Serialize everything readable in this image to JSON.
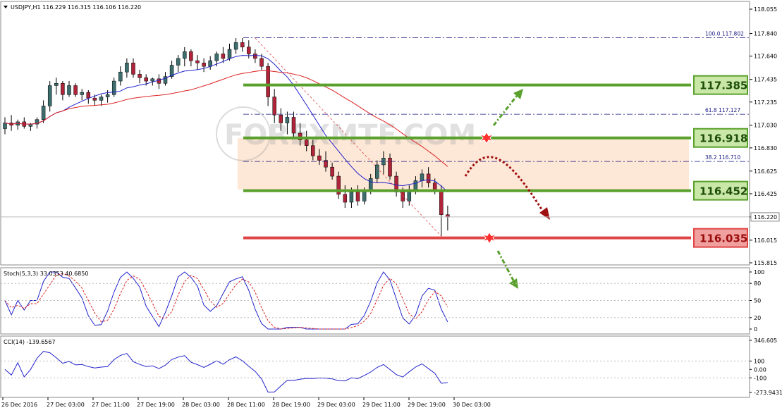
{
  "header": {
    "symbol_info": "USDJPY,H1  116.229 116.315 116.106 116.220",
    "stoch_info": "Stoch(5,3,3) 33.0353 40.6850",
    "cci_info": "CCI(14) -139.6567"
  },
  "watermark": "FOREXMTF.COM",
  "price_axis": {
    "ticks": [
      "118.055",
      "117.840",
      "117.640",
      "117.435",
      "117.235",
      "117.030",
      "116.830",
      "116.625",
      "116.425",
      "116.220",
      "116.015",
      "115.815"
    ],
    "current": "116.220"
  },
  "stoch_axis": {
    "ticks": [
      "100",
      "80",
      "50",
      "20",
      "0"
    ]
  },
  "cci_axis": {
    "ticks": [
      "346.605",
      "100",
      "0.00",
      "-100",
      "-273.9431"
    ]
  },
  "time_axis": {
    "ticks": [
      "26 Dec 2016",
      "27 Dec 03:00",
      "27 Dec 11:00",
      "27 Dec 19:00",
      "28 Dec 03:00",
      "28 Dec 11:00",
      "28 Dec 19:00",
      "29 Dec 03:00",
      "29 Dec 11:00",
      "29 Dec 19:00",
      "30 Dec 03:00"
    ]
  },
  "fib_levels": [
    {
      "label": "100.0  117.802",
      "price": 117.802
    },
    {
      "label": "61.8  117.127",
      "price": 117.127
    },
    {
      "label": "38.2  116.710",
      "price": 116.71
    }
  ],
  "levels": [
    {
      "label": "117.385",
      "price": 117.385,
      "color": "#5aa02c",
      "kind": "resistance"
    },
    {
      "label": "116.918",
      "price": 116.918,
      "color": "#5aa02c",
      "kind": "resistance"
    },
    {
      "label": "116.452",
      "price": 116.452,
      "color": "#5aa02c",
      "kind": "support"
    },
    {
      "label": "116.035",
      "price": 116.035,
      "color": "#e04545",
      "kind": "support"
    }
  ],
  "colors": {
    "bull": "#3d6e6e",
    "bear": "#b0243a",
    "ma_fast": "#2222cc",
    "ma_slow": "#dd2222",
    "green": "#5aa02c",
    "red": "#e04545",
    "zone": "#fde3cf"
  },
  "chart_data": {
    "type": "candlestick",
    "symbol": "USDJPY",
    "timeframe": "H1",
    "ohlc": [
      [
        117.0,
        117.1,
        116.95,
        117.05
      ],
      [
        117.05,
        117.12,
        116.98,
        117.03
      ],
      [
        117.03,
        117.08,
        116.99,
        117.06
      ],
      [
        117.06,
        117.1,
        117.0,
        117.02
      ],
      [
        117.02,
        117.05,
        116.98,
        117.04
      ],
      [
        117.04,
        117.1,
        117.0,
        117.08
      ],
      [
        117.08,
        117.25,
        117.05,
        117.2
      ],
      [
        117.2,
        117.42,
        117.15,
        117.38
      ],
      [
        117.38,
        117.45,
        117.3,
        117.4
      ],
      [
        117.4,
        117.42,
        117.25,
        117.3
      ],
      [
        117.3,
        117.42,
        117.28,
        117.38
      ],
      [
        117.38,
        117.4,
        117.28,
        117.3
      ],
      [
        117.3,
        117.35,
        117.25,
        117.32
      ],
      [
        117.32,
        117.34,
        117.22,
        117.27
      ],
      [
        117.27,
        117.3,
        117.2,
        117.25
      ],
      [
        117.25,
        117.3,
        117.2,
        117.28
      ],
      [
        117.28,
        117.34,
        117.23,
        117.3
      ],
      [
        117.3,
        117.45,
        117.28,
        117.42
      ],
      [
        117.42,
        117.55,
        117.38,
        117.5
      ],
      [
        117.5,
        117.62,
        117.45,
        117.58
      ],
      [
        117.58,
        117.62,
        117.45,
        117.48
      ],
      [
        117.48,
        117.52,
        117.4,
        117.45
      ],
      [
        117.45,
        117.48,
        117.38,
        117.42
      ],
      [
        117.42,
        117.45,
        117.38,
        117.44
      ],
      [
        117.44,
        117.48,
        117.35,
        117.4
      ],
      [
        117.4,
        117.5,
        117.38,
        117.46
      ],
      [
        117.46,
        117.6,
        117.44,
        117.56
      ],
      [
        117.56,
        117.65,
        117.5,
        117.62
      ],
      [
        117.62,
        117.72,
        117.55,
        117.68
      ],
      [
        117.68,
        117.7,
        117.55,
        117.6
      ],
      [
        117.6,
        117.65,
        117.52,
        117.58
      ],
      [
        117.58,
        117.62,
        117.5,
        117.55
      ],
      [
        117.55,
        117.64,
        117.52,
        117.6
      ],
      [
        117.6,
        117.68,
        117.55,
        117.66
      ],
      [
        117.66,
        117.72,
        117.58,
        117.62
      ],
      [
        117.62,
        117.75,
        117.6,
        117.7
      ],
      [
        117.7,
        117.8,
        117.66,
        117.76
      ],
      [
        117.76,
        117.8,
        117.68,
        117.72
      ],
      [
        117.72,
        117.78,
        117.62,
        117.66
      ],
      [
        117.66,
        117.7,
        117.58,
        117.62
      ],
      [
        117.62,
        117.66,
        117.52,
        117.55
      ],
      [
        117.55,
        117.58,
        117.2,
        117.28
      ],
      [
        117.28,
        117.35,
        117.05,
        117.12
      ],
      [
        117.12,
        117.18,
        116.98,
        117.05
      ],
      [
        117.05,
        117.15,
        116.95,
        117.1
      ],
      [
        117.1,
        117.15,
        116.92,
        116.96
      ],
      [
        116.96,
        117.05,
        116.85,
        116.9
      ],
      [
        116.9,
        116.98,
        116.8,
        116.85
      ],
      [
        116.85,
        116.9,
        116.72,
        116.76
      ],
      [
        116.76,
        116.82,
        116.68,
        116.72
      ],
      [
        116.72,
        116.8,
        116.62,
        116.66
      ],
      [
        116.66,
        116.7,
        116.55,
        116.58
      ],
      [
        116.58,
        116.62,
        116.38,
        116.42
      ],
      [
        116.42,
        116.5,
        116.3,
        116.35
      ],
      [
        116.35,
        116.48,
        116.3,
        116.44
      ],
      [
        116.44,
        116.5,
        116.32,
        116.36
      ],
      [
        116.36,
        116.48,
        116.33,
        116.45
      ],
      [
        116.45,
        116.6,
        116.42,
        116.56
      ],
      [
        116.56,
        116.72,
        116.52,
        116.68
      ],
      [
        116.68,
        116.8,
        116.6,
        116.74
      ],
      [
        116.74,
        116.78,
        116.55,
        116.58
      ],
      [
        116.58,
        116.62,
        116.4,
        116.44
      ],
      [
        116.44,
        116.48,
        116.3,
        116.36
      ],
      [
        116.36,
        116.5,
        116.32,
        116.46
      ],
      [
        116.46,
        116.58,
        116.42,
        116.54
      ],
      [
        116.54,
        116.64,
        116.48,
        116.6
      ],
      [
        116.6,
        116.66,
        116.48,
        116.52
      ],
      [
        116.52,
        116.56,
        116.42,
        116.45
      ],
      [
        116.45,
        116.5,
        116.05,
        116.24
      ],
      [
        116.24,
        116.32,
        116.1,
        116.22
      ]
    ],
    "ma_fast_period_hint": "short",
    "stochastic": {
      "main": 33.0353,
      "signal": 40.685,
      "levels": [
        80,
        20
      ]
    },
    "cci": {
      "value": -139.6567,
      "levels": [
        100,
        -100
      ]
    }
  }
}
